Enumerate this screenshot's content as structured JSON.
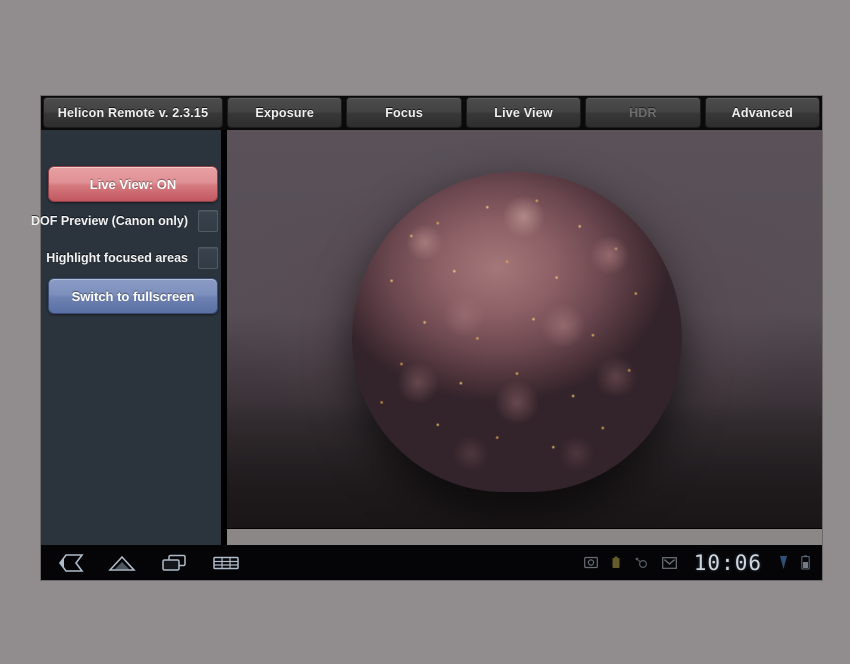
{
  "tabs": [
    {
      "label": "Helicon Remote v. 2.3.15",
      "name": "tab-app-title",
      "state": "title"
    },
    {
      "label": "Exposure",
      "name": "tab-exposure",
      "state": "normal"
    },
    {
      "label": "Focus",
      "name": "tab-focus",
      "state": "normal"
    },
    {
      "label": "Live View",
      "name": "tab-live-view",
      "state": "normal"
    },
    {
      "label": "HDR",
      "name": "tab-hdr",
      "state": "disabled"
    },
    {
      "label": "Advanced",
      "name": "tab-advanced",
      "state": "normal"
    }
  ],
  "sidebar": {
    "live_view_button": "Live View: ON",
    "dof_preview_label": "DOF Preview (Canon only)",
    "dof_preview_checked": false,
    "highlight_focus_label": "Highlight focused areas",
    "highlight_focus_checked": false,
    "fullscreen_button": "Switch to fullscreen"
  },
  "live_view": {
    "subject": "pine cone with glitter",
    "background_color": "#564d55"
  },
  "system_bar": {
    "nav": [
      {
        "name": "back-icon",
        "label": "Back"
      },
      {
        "name": "home-icon",
        "label": "Home"
      },
      {
        "name": "recents-icon",
        "label": "Recent apps"
      },
      {
        "name": "keyboard-icon",
        "label": "Keyboard"
      }
    ],
    "status": [
      {
        "name": "screenshot-icon",
        "label": "Screenshot"
      },
      {
        "name": "usb-icon",
        "label": "USB"
      },
      {
        "name": "sync-icon",
        "label": "Sync"
      },
      {
        "name": "gmail-icon",
        "label": "Gmail"
      }
    ],
    "clock": "10:06",
    "indicators": [
      {
        "name": "signal-icon",
        "label": "Signal"
      },
      {
        "name": "battery-icon",
        "label": "Battery"
      }
    ]
  },
  "colors": {
    "page_background": "#918c8d",
    "sidebar": "#2b333d",
    "accent_red": "#d4797f",
    "accent_blue": "#6d81b2"
  }
}
